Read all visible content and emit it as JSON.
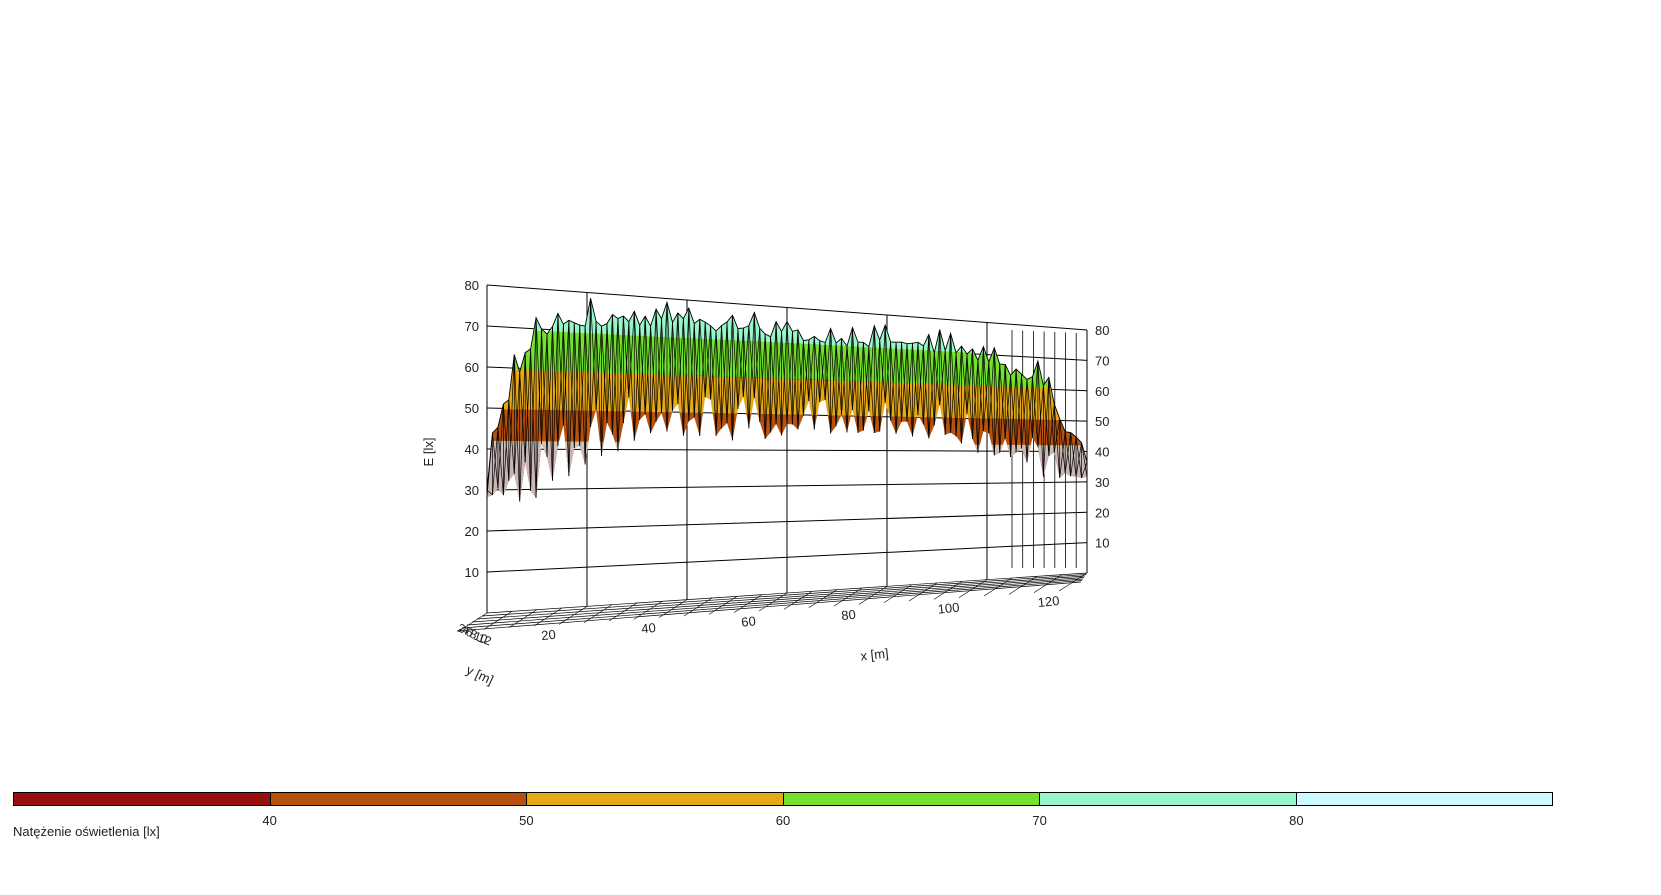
{
  "chart_data": {
    "type": "surface3d",
    "zlabel": "E [lx]",
    "xlabel": "x [m]",
    "ylabel": "y [m]",
    "zlim": [
      0,
      80
    ],
    "xlim": [
      0,
      120
    ],
    "z_ticks": [
      "10",
      "20",
      "30",
      "40",
      "50",
      "60",
      "70",
      "80"
    ],
    "x_ticks": [
      "20",
      "40",
      "60",
      "80",
      "100",
      "120"
    ],
    "y_ticks": [
      "2",
      "4",
      "6",
      "8",
      "10",
      "12"
    ],
    "x_m": [
      0,
      10,
      20,
      30,
      40,
      50,
      60,
      70,
      80,
      90,
      100,
      110,
      120
    ],
    "mean_illuminance_lx": [
      30,
      66,
      70,
      71,
      72,
      72,
      71,
      70,
      70,
      69,
      66,
      60,
      35
    ],
    "min_illuminance_lx": [
      28,
      25,
      35,
      42,
      42,
      42,
      42,
      42,
      42,
      42,
      38,
      32,
      30
    ],
    "max_illuminance_lx": [
      60,
      76,
      79,
      80,
      80,
      79,
      78,
      78,
      77,
      77,
      75,
      70,
      55
    ],
    "legend": {
      "title": "Natężenie oświetlenia [lx]",
      "ticks": [
        "40",
        "50",
        "60",
        "70",
        "80"
      ],
      "bands": [
        {
          "range": "<40",
          "color": "#9b0e0e"
        },
        {
          "range": "40-50",
          "color": "#b6510e"
        },
        {
          "range": "50-60",
          "color": "#e6a917"
        },
        {
          "range": "60-70",
          "color": "#74e12e"
        },
        {
          "range": "70-80",
          "color": "#98f5c8"
        },
        {
          "range": ">80",
          "color": "#ccfbff"
        }
      ]
    }
  }
}
